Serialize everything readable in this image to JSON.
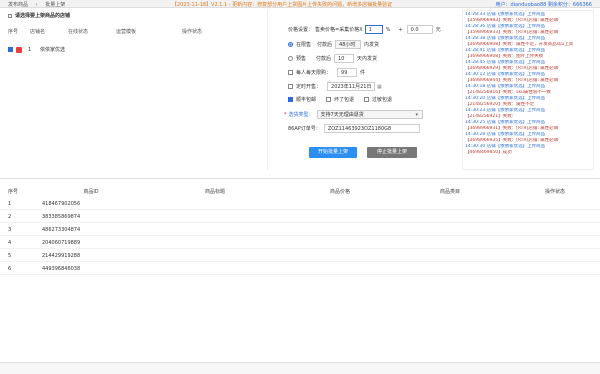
{
  "header": {
    "crumbs": [
      "发布商品",
      "批量上架"
    ],
    "notice": "【2023-11-18】V2.1.1 - 更新内容：修复部分用户上货图片上传失败的问题，新增多店铺批量验证",
    "user": "用户：dianduobao88  剩余积分：666366"
  },
  "store": {
    "title": "请选择要上架商品的店铺",
    "columns": [
      "序号",
      "店铺名",
      "在线状态",
      "运营模板",
      "操作状态"
    ],
    "rows": [
      {
        "index": "1",
        "name": "依依家优选"
      }
    ]
  },
  "settings": {
    "price_label": "价格设置：",
    "price_formula": "售卖价格=采集价格X",
    "multiplier": "1",
    "percent": "%",
    "plus": "+",
    "add_value": "0.0",
    "yuan": "元",
    "radio_ship": {
      "label": "在限售",
      "unit_label": "付款后",
      "select": "48小时",
      "suffix": "内发货"
    },
    "radio_presale": {
      "label": "预售",
      "unit_label": "付款后",
      "value": "10",
      "suffix": "天内发货"
    },
    "limit": {
      "label": "每人每天限购：",
      "value": "99",
      "unit": "件"
    },
    "timed": {
      "label": "定时开售：",
      "value": "2023年11月21日"
    },
    "options": [
      "顺丰包邮",
      "坏了包退",
      "过敏包退"
    ],
    "shipping": {
      "label": "选货类型：",
      "value": "支持7天无理由退货"
    },
    "order_label": "86AP订单号：",
    "order_value": "ZOZ11463923OZ1180G8",
    "start_button": "开始批量上架",
    "stop_button": "停止批量上架"
  },
  "log": [
    "14:28:33 店铺【依依家优选】上传商品",
    "【3598966983】失败：[RTR]店铺: 属性必填",
    "14:28:36 店铺【依依家优选】上传商品",
    "【3598966933】失败：[RTR]店铺: 属性必填",
    "14:28:38 店铺【依依家优选】上传商品",
    "【3698966908】失败：属性不足，开发商品sku上架",
    "14:28:41 店铺【依依家优选】上传商品",
    "【3698966908】失败：图片上传失败",
    "14:28:45 店铺【依依家优选】上传商品",
    "【3698966929】失败：[RTR]店铺: 属性必填",
    "14:30:12 店铺【依依家优选】上传商品",
    "【3698966944】失败：[RTR]店铺: 属性必填",
    "14:30:18 店铺【依依家优选】上传商品",
    "【2148256916】失败：sku属性值不一致",
    "14:30:20 店铺【依依家优选】上传商品",
    "【2148256920】失败：属性不足",
    "14:30:23 店铺【依依家优选】上传商品",
    "【2148256921】失败：",
    "14:30:25 店铺【依依家优选】上传商品",
    "【3698966931】失败：[RTR]店铺: 属性必填",
    "14:30:28 店铺【依依家优选】上传商品",
    "【3698966935】失败：[RTR]店铺: 属性必填",
    "14:30:30 店铺【依依家优选】上传商品",
    "【4698469850】成功"
  ],
  "products": {
    "columns": [
      "序号",
      "商品ID",
      "商品标题",
      "商品价格",
      "商品类目",
      "操作状态"
    ],
    "rows": [
      {
        "index": "1",
        "id": "418467902056"
      },
      {
        "index": "2",
        "id": "383385869874"
      },
      {
        "index": "3",
        "id": "486273304874"
      },
      {
        "index": "4",
        "id": "204060719889"
      },
      {
        "index": "5",
        "id": "214429919288"
      },
      {
        "index": "6",
        "id": "449396846038"
      }
    ]
  }
}
